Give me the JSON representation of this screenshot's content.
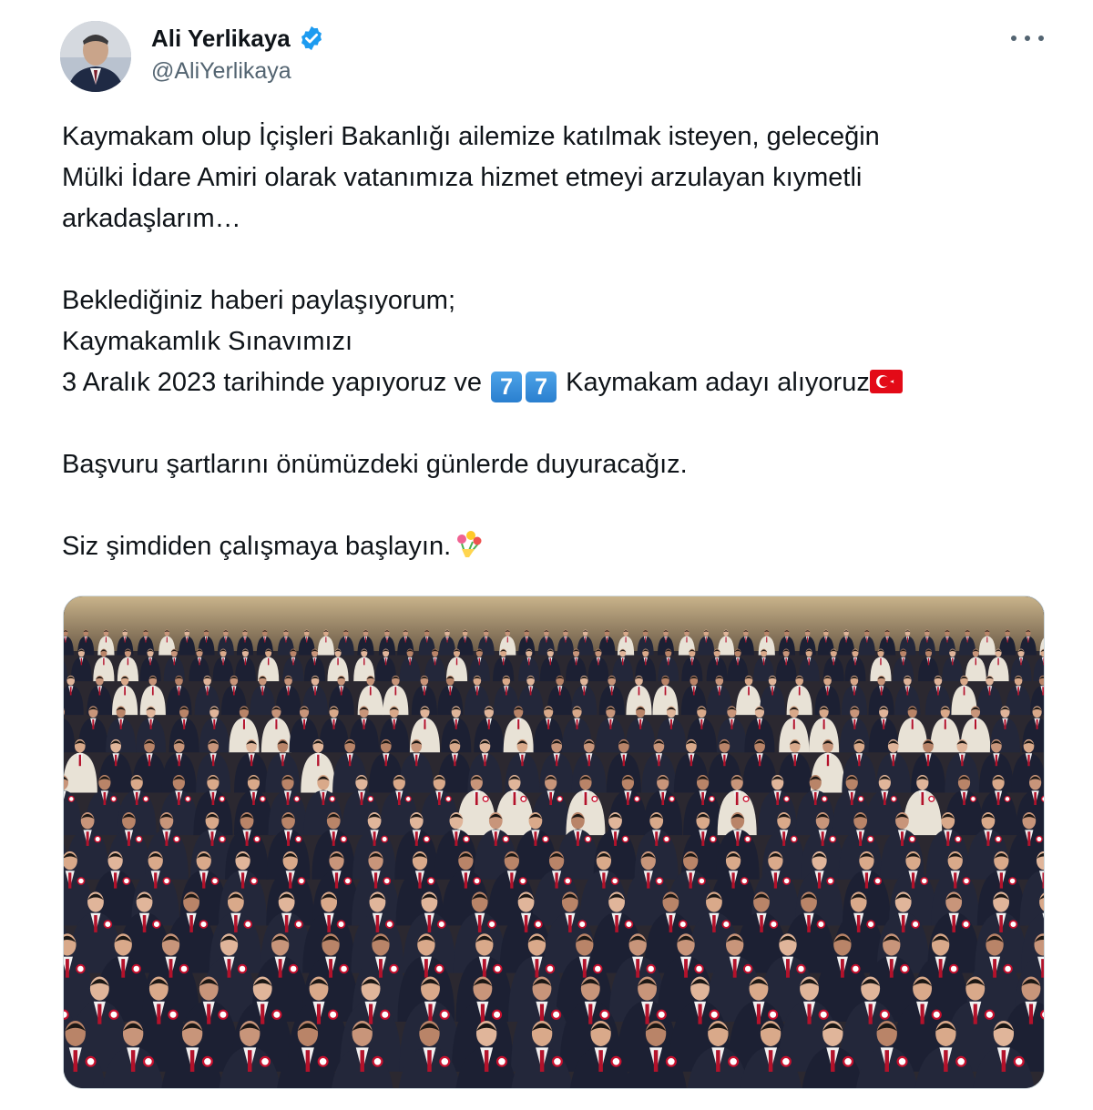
{
  "author": {
    "display_name": "Ali Yerlikaya",
    "handle": "@AliYerlikaya",
    "verified_icon": "verified-badge-icon"
  },
  "tweet": {
    "line1": "Kaymakam olup İçişleri Bakanlığı ailemize katılmak isteyen, geleceğin",
    "line2": "Mülki İdare Amiri olarak vatanımıza hizmet etmeyi arzulayan kıymetli",
    "line3": "arkadaşlarım…",
    "line4": "Beklediğiniz haberi paylaşıyorum;",
    "line5": "Kaymakamlık Sınavımızı",
    "line6_before": "3 Aralık 2023 tarihinde yapıyoruz ve ",
    "keycap1": "7",
    "keycap2": "7",
    "line6_after": " Kaymakam adayı alıyoruz",
    "line7": "Başvuru şartlarını önümüzdeki günlerde duyuracağız.",
    "line8": "Siz şimdiden çalışmaya başlayın."
  },
  "colors": {
    "text": "#0f1419",
    "secondary": "#536471",
    "verified_blue": "#1d9bf0",
    "border": "#cfd9de"
  },
  "icons": {
    "more": "more-options-icon",
    "flag": "turkey-flag-icon",
    "bouquet": "bouquet-icon"
  }
}
